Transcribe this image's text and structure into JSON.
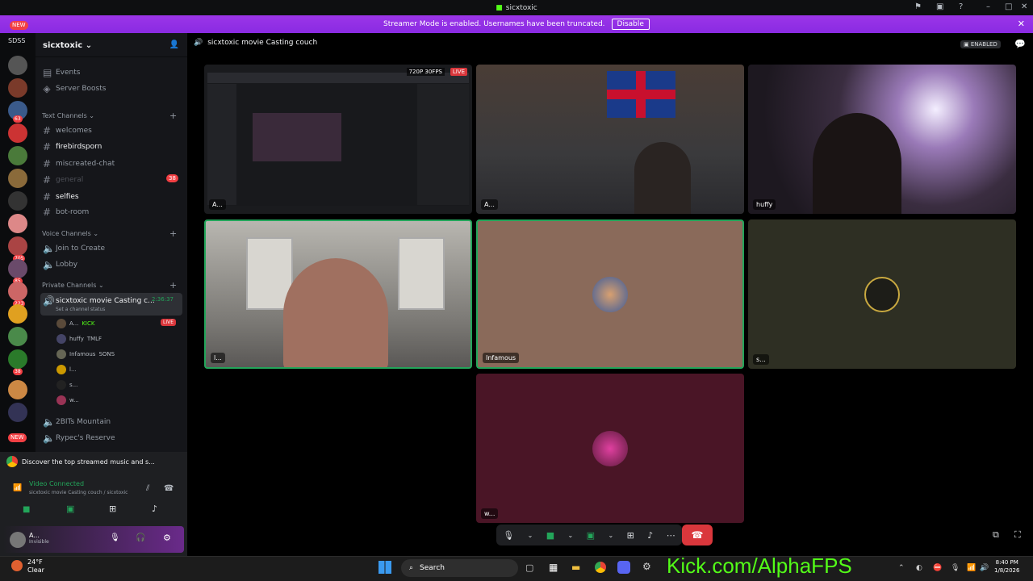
{
  "window": {
    "title": "sicxtoxic"
  },
  "banner": {
    "text": "Streamer Mode is enabled. Usernames have been truncated.",
    "button": "Disable"
  },
  "guilds": {
    "top_badge": "NEW",
    "label": "SDSS",
    "badges": [
      "63",
      "705",
      "85",
      "223",
      "38"
    ],
    "bottom_badge": "NEW"
  },
  "server": {
    "name": "sicxtoxic"
  },
  "sidebar": {
    "events": "Events",
    "boosts": "Server Boosts",
    "text_category": "Text Channels",
    "text_channels": [
      "welcomes",
      "firebirdsporn",
      "miscreated-chat",
      "general",
      "selfies",
      "bot-room"
    ],
    "general_badge": "38",
    "voice_category": "Voice Channels",
    "voice_channels": [
      "Join to Create",
      "Lobby"
    ],
    "private_category": "Private Channels",
    "active_channel": "sicxtoxic movie Casting c...",
    "active_timer": "2:36:37",
    "status_hint": "Set a channel status",
    "users": [
      {
        "name": "A...",
        "tag": "KICK",
        "live": "LIVE"
      },
      {
        "name": "huffy",
        "tag": "TMLF"
      },
      {
        "name": "Infamous",
        "tag": "SONS"
      },
      {
        "name": "l..."
      },
      {
        "name": "s..."
      },
      {
        "name": "w..."
      }
    ],
    "other_channels": [
      "2BITs Mountain",
      "Rypec's Reserve"
    ]
  },
  "panel": {
    "discover": "Discover the top streamed music and s...",
    "vc_status": "Video Connected",
    "vc_channel": "sicxtoxic movie Casting couch / sicxtoxic",
    "user": "A...",
    "user_status": "Invisible"
  },
  "main": {
    "channel_title": "sicxtoxic movie Casting couch",
    "enabled": "ENABLED",
    "stream_quality": "720P 30FPS",
    "live": "LIVE",
    "tiles": [
      {
        "label": "A..."
      },
      {
        "label": "A..."
      },
      {
        "label": "huffy"
      },
      {
        "label": "l..."
      },
      {
        "label": "Infamous"
      },
      {
        "label": "s..."
      },
      {
        "label": "w..."
      }
    ]
  },
  "taskbar": {
    "temp": "24°F",
    "weather": "Clear",
    "search": "Search",
    "overlay": "Kick.com/AlphaFPS",
    "time": "8:40 PM",
    "date": "1/8/2026"
  },
  "colors": {
    "accent": "#8a2be2",
    "kick_green": "#53fc18",
    "hangup": "#da373c"
  }
}
